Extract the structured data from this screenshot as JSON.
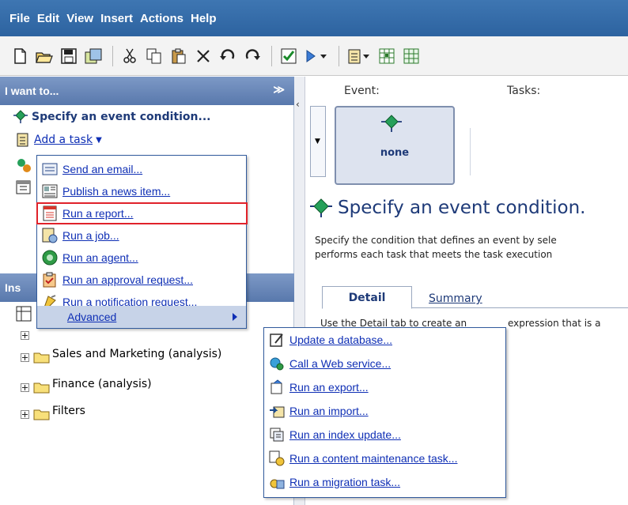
{
  "menubar": {
    "items": [
      "File",
      "Edit",
      "View",
      "Insert",
      "Actions",
      "Help"
    ]
  },
  "left": {
    "header": "I want to...",
    "header_chevron": "≫",
    "specify_event": "Specify an event condition...",
    "add_task": "Add a task",
    "add_task_arrow": "▼",
    "insertable_header": "Ins",
    "tree": [
      {
        "label": "Sales and Marketing (analysis)"
      },
      {
        "label": "Finance (analysis)"
      },
      {
        "label": "Filters"
      }
    ]
  },
  "task_menu": {
    "items": [
      {
        "label": "Send an email...",
        "icon": "email-icon"
      },
      {
        "label": "Publish a news item...",
        "icon": "news-icon"
      },
      {
        "label": "Run a report...",
        "icon": "report-icon",
        "highlighted": true
      },
      {
        "label": "Run a job...",
        "icon": "job-icon"
      },
      {
        "label": "Run an agent...",
        "icon": "agent-icon"
      },
      {
        "label": "Run an approval request...",
        "icon": "approval-icon"
      },
      {
        "label": "Run a notification request...",
        "icon": "notification-icon"
      },
      {
        "label": "Advanced",
        "icon": "",
        "submenu": true
      }
    ]
  },
  "advanced_menu": {
    "items": [
      {
        "label": "Update a database...",
        "icon": "database-icon"
      },
      {
        "label": "Call a Web service...",
        "icon": "web-service-icon"
      },
      {
        "label": "Run an export...",
        "icon": "export-icon"
      },
      {
        "label": "Run an import...",
        "icon": "import-icon"
      },
      {
        "label": "Run an index update...",
        "icon": "index-icon"
      },
      {
        "label": "Run a content maintenance task...",
        "icon": "maintenance-icon"
      },
      {
        "label": "Run a migration task...",
        "icon": "migration-icon"
      }
    ]
  },
  "right": {
    "event_label": "Event:",
    "tasks_label": "Tasks:",
    "event_box_label": "none",
    "title": "Specify an event condition.",
    "desc_line1": "Specify the condition that defines an event by sele",
    "desc_line2": "performs each task that meets the task execution",
    "tabs": [
      "Detail",
      "Summary"
    ],
    "detail_text_left": "Use the Detail tab to create an",
    "detail_text_right": "expression that is a"
  },
  "colors": {
    "menubar": "#3e76b2",
    "pane_header": "#6b89bb",
    "link": "#0f2fb5",
    "highlight": "#e0222a"
  }
}
